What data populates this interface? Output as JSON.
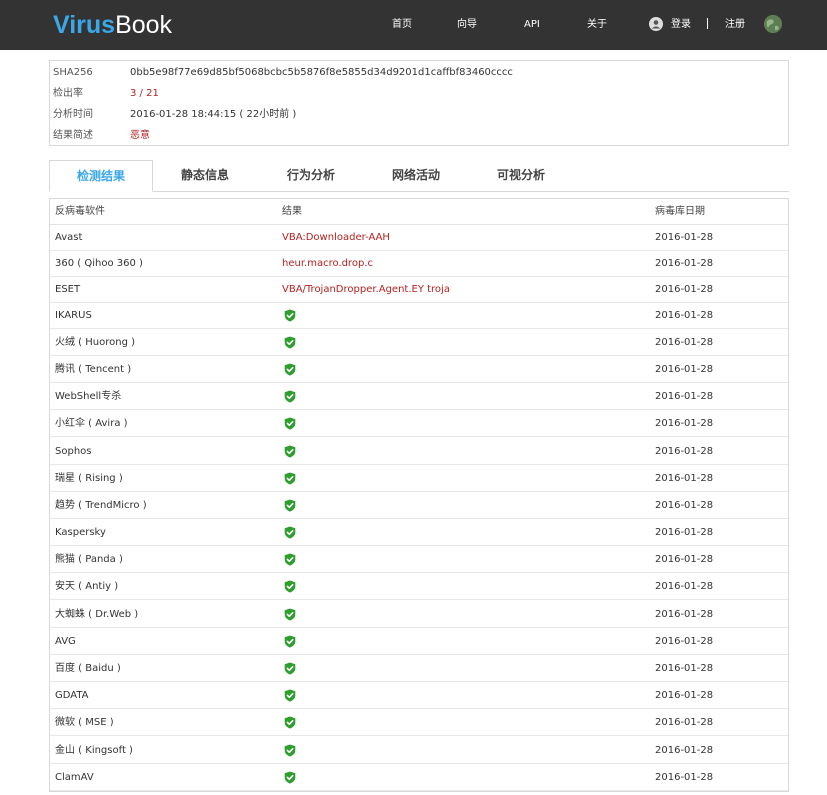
{
  "header": {
    "logo_part1": "Virus",
    "logo_part2": "Book",
    "nav": [
      "首页",
      "向导",
      "API",
      "关于"
    ],
    "login": "登录",
    "register": "注册"
  },
  "info": {
    "rows": [
      {
        "label": "SHA256",
        "value": "0bb5e98f77e69d85bf5068bcbc5b5876f8e5855d34d9201d1caffbf83460cccc"
      },
      {
        "label": "检出率",
        "value": "3 / 21"
      },
      {
        "label": "分析时间",
        "value": "2016-01-28 18:44:15 ( 22小时前 )"
      },
      {
        "label": "结果简述",
        "value": "恶意"
      }
    ]
  },
  "tabs": [
    "检测结果",
    "静态信息",
    "行为分析",
    "网络活动",
    "可视分析"
  ],
  "table": {
    "headers": [
      "反病毒软件",
      "结果",
      "病毒库日期"
    ],
    "rows": [
      {
        "engine": "Avast",
        "result": "VBA:Downloader-AAH",
        "date": "2016-01-28"
      },
      {
        "engine": "360 ( Qihoo 360 )",
        "result": "heur.macro.drop.c",
        "date": "2016-01-28"
      },
      {
        "engine": "ESET",
        "result": "VBA/TrojanDropper.Agent.EY troja",
        "date": "2016-01-28"
      },
      {
        "engine": "IKARUS",
        "result": "",
        "date": "2016-01-28"
      },
      {
        "engine": "火绒 ( Huorong )",
        "result": "",
        "date": "2016-01-28"
      },
      {
        "engine": "腾讯 ( Tencent )",
        "result": "",
        "date": "2016-01-28"
      },
      {
        "engine": "WebShell专杀",
        "result": "",
        "date": "2016-01-28"
      },
      {
        "engine": "小红伞 ( Avira )",
        "result": "",
        "date": "2016-01-28"
      },
      {
        "engine": "Sophos",
        "result": "",
        "date": "2016-01-28"
      },
      {
        "engine": "瑞星 ( Rising )",
        "result": "",
        "date": "2016-01-28"
      },
      {
        "engine": "趋势 ( TrendMicro )",
        "result": "",
        "date": "2016-01-28"
      },
      {
        "engine": "Kaspersky",
        "result": "",
        "date": "2016-01-28"
      },
      {
        "engine": "熊猫 ( Panda )",
        "result": "",
        "date": "2016-01-28"
      },
      {
        "engine": "安天 ( Antiy )",
        "result": "",
        "date": "2016-01-28"
      },
      {
        "engine": "大蜘蛛 ( Dr.Web )",
        "result": "",
        "date": "2016-01-28"
      },
      {
        "engine": "AVG",
        "result": "",
        "date": "2016-01-28"
      },
      {
        "engine": "百度 ( Baidu )",
        "result": "",
        "date": "2016-01-28"
      },
      {
        "engine": "GDATA",
        "result": "",
        "date": "2016-01-28"
      },
      {
        "engine": "微软 ( MSE )",
        "result": "",
        "date": "2016-01-28"
      },
      {
        "engine": "金山 ( Kingsoft )",
        "result": "",
        "date": "2016-01-28"
      },
      {
        "engine": "ClamAV",
        "result": "",
        "date": "2016-01-28"
      }
    ]
  },
  "colors": {
    "accent": "#3aa7e8",
    "malicious": "#b22222",
    "clean": "#2e9e2e",
    "topbar": "#333333"
  }
}
